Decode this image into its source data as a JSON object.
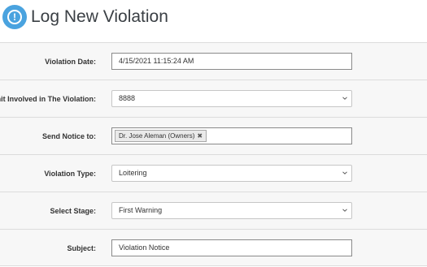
{
  "header": {
    "icon": "alert-circle-icon",
    "icon_glyph": "!",
    "title": "Log New Violation",
    "accent_color": "#4aa3df"
  },
  "form": {
    "violation_date": {
      "label": "Violation Date:",
      "value": "4/15/2021 11:15:24 AM"
    },
    "unit": {
      "label": "Unit Involved in The Violation:",
      "value": "8888"
    },
    "send_notice": {
      "label": "Send Notice to:",
      "tags": [
        "Dr. Jose Aleman (Owners)"
      ],
      "remove_glyph": "✖"
    },
    "violation_type": {
      "label": "Violation Type:",
      "value": "Loitering"
    },
    "stage": {
      "label": "Select Stage:",
      "value": "First Warning"
    },
    "subject": {
      "label": "Subject:",
      "value": "Violation Notice"
    }
  }
}
